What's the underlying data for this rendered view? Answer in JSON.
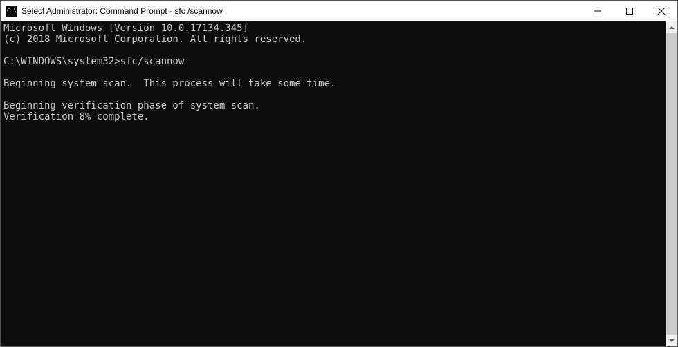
{
  "titlebar": {
    "icon_label": "C:\\",
    "title": "Select Administrator: Command Prompt - sfc /scannow"
  },
  "terminal": {
    "line1": "Microsoft Windows [Version 10.0.17134.345]",
    "line2": "(c) 2018 Microsoft Corporation. All rights reserved.",
    "blank1": "",
    "prompt": "C:\\WINDOWS\\system32>",
    "command": "sfc/scannow",
    "blank2": "",
    "line3": "Beginning system scan.  This process will take some time.",
    "blank3": "",
    "line4": "Beginning verification phase of system scan.",
    "line5": "Verification 8% complete."
  }
}
